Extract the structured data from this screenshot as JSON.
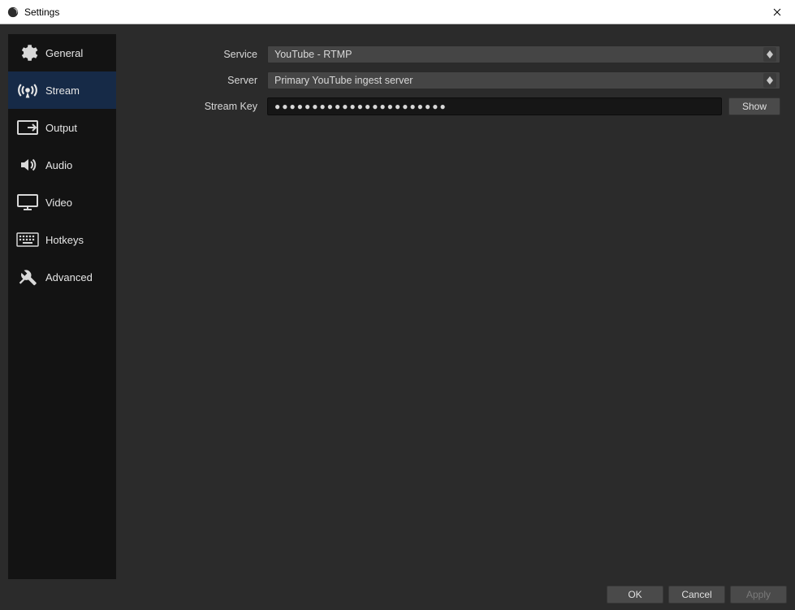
{
  "window": {
    "title": "Settings"
  },
  "sidebar": {
    "items": [
      {
        "id": "general",
        "label": "General",
        "icon": "gear-icon"
      },
      {
        "id": "stream",
        "label": "Stream",
        "icon": "antenna-icon"
      },
      {
        "id": "output",
        "label": "Output",
        "icon": "output-icon"
      },
      {
        "id": "audio",
        "label": "Audio",
        "icon": "speaker-icon"
      },
      {
        "id": "video",
        "label": "Video",
        "icon": "monitor-icon"
      },
      {
        "id": "hotkeys",
        "label": "Hotkeys",
        "icon": "keyboard-icon"
      },
      {
        "id": "advanced",
        "label": "Advanced",
        "icon": "tools-icon"
      }
    ],
    "selected": "stream"
  },
  "form": {
    "service": {
      "label": "Service",
      "value": "YouTube - RTMP"
    },
    "server": {
      "label": "Server",
      "value": "Primary YouTube ingest server"
    },
    "streamkey": {
      "label": "Stream Key",
      "masked_value": "●●●●●●●●●●●●●●●●●●●●●●●",
      "show_label": "Show"
    }
  },
  "footer": {
    "ok": "OK",
    "cancel": "Cancel",
    "apply": "Apply"
  }
}
